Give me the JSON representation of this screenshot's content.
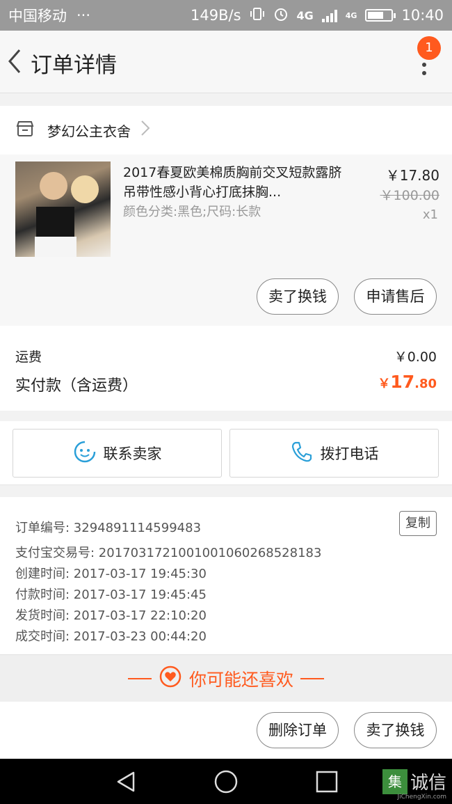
{
  "status_bar": {
    "carrier": "中国移动",
    "dots": "···",
    "speed": "149B/s",
    "network": "4G",
    "network2": "4G",
    "time": "10:40"
  },
  "header": {
    "title": "订单详情",
    "badge_count": "1"
  },
  "shop": {
    "name": "梦幻公主衣舍"
  },
  "item": {
    "title": "2017春夏欧美棉质胸前交叉短款露脐吊带性感小背心打底抹胸...",
    "sku": "颜色分类:黑色;尺码:长款",
    "price": "￥17.80",
    "original_price": "￥100.00",
    "quantity": "x1",
    "actions": [
      "卖了换钱",
      "申请售后"
    ]
  },
  "fees": {
    "shipping_label": "运费",
    "shipping_value": "￥0.00",
    "paid_label": "实付款（含运费）",
    "paid_currency": "￥",
    "paid_integer": "17",
    "paid_decimal": ".80"
  },
  "contact": {
    "seller_label": "联系卖家",
    "phone_label": "拨打电话"
  },
  "order_info": {
    "copy_label": "复制",
    "rows": [
      "订单编号: 3294891114599483",
      "支付宝交易号: 2017031721001001060268528183",
      "创建时间: 2017-03-17 19:45:30",
      "付款时间: 2017-03-17 19:45:45",
      "发货时间: 2017-03-17 22:10:20",
      "成交时间: 2017-03-23 00:44:20"
    ]
  },
  "recommend": {
    "label": "你可能还喜欢"
  },
  "bottom_actions": [
    "删除订单",
    "卖了换钱"
  ],
  "watermark": {
    "logo_text": "集",
    "text": "诚信",
    "subtext": "JiChengXin.com"
  },
  "colors": {
    "accent": "#ff5a1e",
    "status_bar_bg": "#9a9a9a",
    "icon_blue": "#2a9fd8"
  }
}
